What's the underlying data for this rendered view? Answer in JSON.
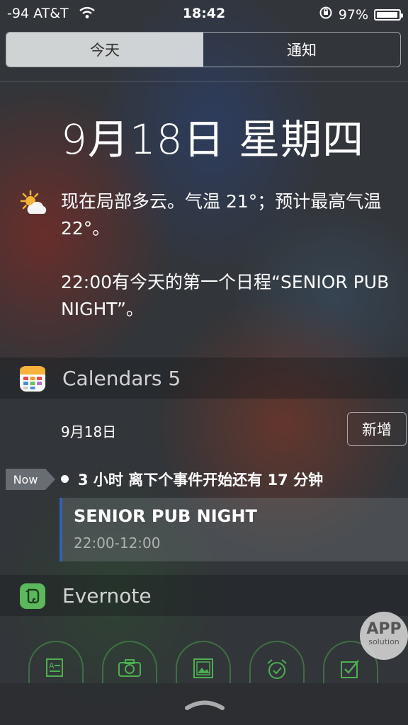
{
  "status_bar": {
    "carrier": "-94 AT&T",
    "time": "18:42",
    "battery": "97%"
  },
  "tabs": [
    {
      "label": "今天",
      "active": true
    },
    {
      "label": "通知",
      "active": false
    }
  ],
  "today": {
    "date_line": "9月18日 星期四",
    "weather_icon": "partly-cloudy-icon",
    "weather_text": "现在局部多云。气温 21°；预计最高气温 22°。",
    "schedule_text": "22:00有今天的第一个日程“SENIOR PUB NIGHT”。"
  },
  "calendars_widget": {
    "app_name": "Calendars 5",
    "date": "9月18日",
    "add_label": "新增",
    "now_label": "Now",
    "countdown": "3 小时 离下个事件开始还有 17 分钟",
    "event": {
      "name": "SENIOR PUB NIGHT",
      "time": "22:00-12:00",
      "color": "#3560b0"
    }
  },
  "evernote_widget": {
    "app_name": "Evernote",
    "actions": [
      "text-note-icon",
      "camera-icon",
      "photo-icon",
      "reminder-icon",
      "checklist-icon"
    ],
    "accent": "#4caf50"
  },
  "watermark": {
    "line1": "APP",
    "line2": "solution"
  }
}
